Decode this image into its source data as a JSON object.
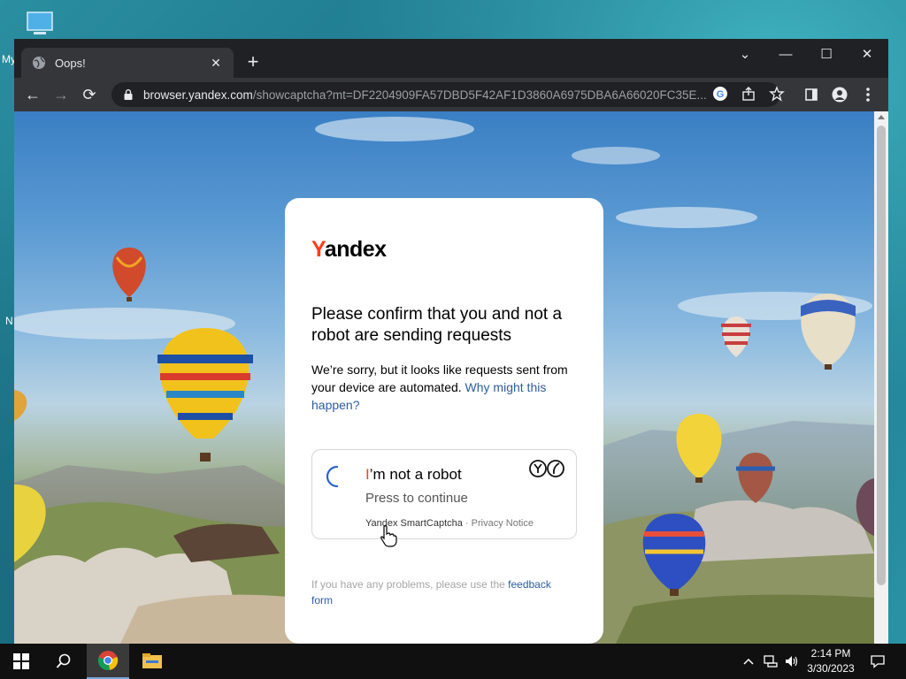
{
  "desktop": {
    "label_1": "My",
    "label_2": "N"
  },
  "browser": {
    "tab": {
      "title": "Oops!",
      "close": "✕"
    },
    "new_tab": "+",
    "window": {
      "dropdown": "⌄",
      "minimize": "—",
      "maximize": "☐",
      "close": "✕"
    },
    "toolbar": {
      "back": "←",
      "forward": "→",
      "reload": "⟳"
    },
    "url": {
      "host": "browser.yandex.com",
      "path": "/showcaptcha?mt=DF2204909FA57DBD5F42AF1D3860A6975DBA6A66020FC35E..."
    }
  },
  "page": {
    "logo": {
      "first": "Y",
      "rest": "andex"
    },
    "headline": "Please confirm that you and not a robot are sending requests",
    "description": "We’re sorry, but it looks like requests sent from your device are automated. ",
    "why_link": "Why might this happen?",
    "captcha": {
      "title_first": "I",
      "title_rest": "’m not a robot",
      "subtitle": "Press to continue",
      "brand": "Yandex SmartCaptcha",
      "separator": " · ",
      "privacy": "Privacy Notice"
    },
    "problems_text": "If you have any problems, please use the ",
    "feedback_link": "feedback form"
  },
  "taskbar": {
    "time": "2:14 PM",
    "date": "3/30/2023"
  },
  "colors": {
    "yandex_red": "#fc3f1d",
    "link_blue": "#2d5c9e",
    "chrome_dark": "#202124",
    "chrome_toolbar": "#35363a"
  }
}
